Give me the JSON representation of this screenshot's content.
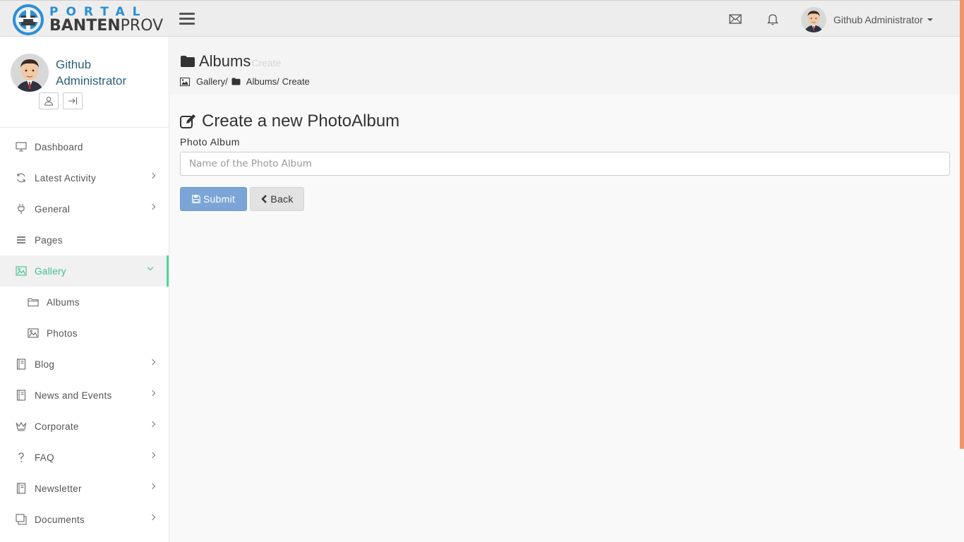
{
  "navbar": {
    "logo_top": "PORTAL",
    "logo_bottom_bold": "BANTEN",
    "logo_bottom_light": "PROV",
    "icons": [
      "menu-icon",
      "envelope-icon",
      "bell-icon"
    ],
    "user_name": "Github Administrator"
  },
  "sidebar": {
    "profile_name": "Github Administrator",
    "profile_buttons": [
      "user-icon",
      "logout-icon"
    ],
    "items": [
      {
        "label": "Dashboard",
        "icon": "monitor-icon",
        "chevron": false
      },
      {
        "label": "Latest Activity",
        "icon": "refresh-icon",
        "chevron": true
      },
      {
        "label": "General",
        "icon": "plug-icon",
        "chevron": true
      },
      {
        "label": "Pages",
        "icon": "list-icon",
        "chevron": false
      },
      {
        "label": "Gallery",
        "icon": "picture-icon",
        "chevron": true,
        "active": true
      },
      {
        "label": "Albums",
        "icon": "folder-icon",
        "sub": true
      },
      {
        "label": "Photos",
        "icon": "picture-icon",
        "sub": true
      },
      {
        "label": "Blog",
        "icon": "notebook-icon",
        "chevron": true
      },
      {
        "label": "News and Events",
        "icon": "notebook-icon",
        "chevron": true
      },
      {
        "label": "Corporate",
        "icon": "crown-icon",
        "chevron": true
      },
      {
        "label": "FAQ",
        "icon": "question-icon",
        "chevron": true
      },
      {
        "label": "Newsletter",
        "icon": "notebook-icon",
        "chevron": true
      },
      {
        "label": "Documents",
        "icon": "document-icon",
        "chevron": true
      }
    ]
  },
  "header": {
    "title": "Albums",
    "subtitle": "Create",
    "breadcrumb": [
      "Gallery/",
      "Albums/",
      "Create"
    ]
  },
  "form": {
    "title": "Create a new PhotoAlbum",
    "label": "Photo Album",
    "placeholder": "Name of the Photo Album",
    "value": "",
    "submit_label": "Submit",
    "back_label": "Back"
  },
  "colors": {
    "accent_green": "#3dbf8a",
    "primary_button": "#7aa5d6",
    "logo_blue": "#2a8fd6",
    "scroll_accent": "#f0956a"
  }
}
